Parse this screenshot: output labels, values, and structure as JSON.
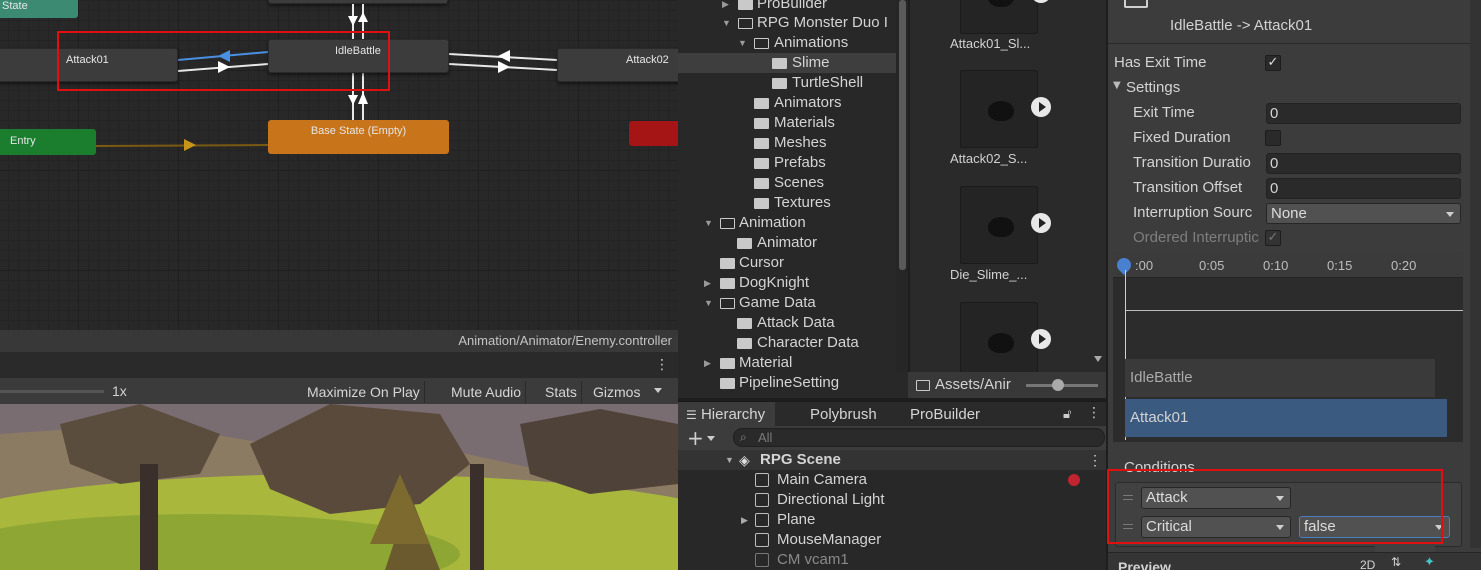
{
  "animator": {
    "nodes": {
      "any_state": "State",
      "attack01": "Attack01",
      "idle_battle": "IdleBattle",
      "attack02": "Attack02",
      "entry": "Entry",
      "base_state": "Base State (Empty)"
    },
    "path": "Animation/Animator/Enemy.controller"
  },
  "game_view": {
    "scale_label": "1x",
    "toolbar": [
      "Maximize On Play",
      "Mute Audio",
      "Stats",
      "Gizmos"
    ]
  },
  "project": {
    "tree": [
      {
        "label": "ProBuilder"
      },
      {
        "label": "RPG Monster Duo I"
      },
      {
        "label": "Animations"
      },
      {
        "label": "Slime"
      },
      {
        "label": "TurtleShell"
      },
      {
        "label": "Animators"
      },
      {
        "label": "Materials"
      },
      {
        "label": "Meshes"
      },
      {
        "label": "Prefabs"
      },
      {
        "label": "Scenes"
      },
      {
        "label": "Textures"
      },
      {
        "label": "Animation"
      },
      {
        "label": "Animator"
      },
      {
        "label": "Cursor"
      },
      {
        "label": "DogKnight"
      },
      {
        "label": "Game Data"
      },
      {
        "label": "Attack Data"
      },
      {
        "label": "Character Data"
      },
      {
        "label": "Material"
      },
      {
        "label": "PipelineSetting"
      }
    ],
    "assets": [
      {
        "name": "Attack01_Sl..."
      },
      {
        "name": "Attack02_S..."
      },
      {
        "name": "Die_Slime_..."
      }
    ],
    "breadcrumb": "Assets/Anir"
  },
  "hierarchy": {
    "tabs": [
      "Hierarchy",
      "Polybrush",
      "ProBuilder"
    ],
    "search_placeholder": "All",
    "scene": "RPG Scene",
    "items": [
      {
        "label": "Main Camera"
      },
      {
        "label": "Directional Light"
      },
      {
        "label": "Plane"
      },
      {
        "label": "MouseManager"
      },
      {
        "label": "CM vcam1"
      }
    ]
  },
  "inspector": {
    "transition_title": "IdleBattle -> Attack01",
    "has_exit_time_label": "Has Exit Time",
    "settings_label": "Settings",
    "exit_time_label": "Exit Time",
    "exit_time_value": "0",
    "fixed_duration_label": "Fixed Duration",
    "transition_duration_label": "Transition Duratio",
    "transition_duration_value": "0",
    "transition_offset_label": "Transition Offset",
    "transition_offset_value": "0",
    "interruption_source_label": "Interruption Sourc",
    "interruption_source_value": "None",
    "ordered_interruption_label": "Ordered Interruptic",
    "timeline_ticks": [
      ":00",
      "0:05",
      "0:10",
      "0:15",
      "0:20"
    ],
    "track_from": "IdleBattle",
    "track_to": "Attack01",
    "conditions_label": "Conditions",
    "conditions": [
      {
        "param": "Attack"
      },
      {
        "param": "Critical",
        "value": "false"
      }
    ],
    "preview_label": "Preview",
    "preview_mode": "2D"
  },
  "colors": {
    "highlight": "#e01010",
    "transition_arrow": "#4a90e2",
    "entry_node": "#1b7d2e",
    "default_node": "#c8741a",
    "exit_node": "#a51515"
  }
}
